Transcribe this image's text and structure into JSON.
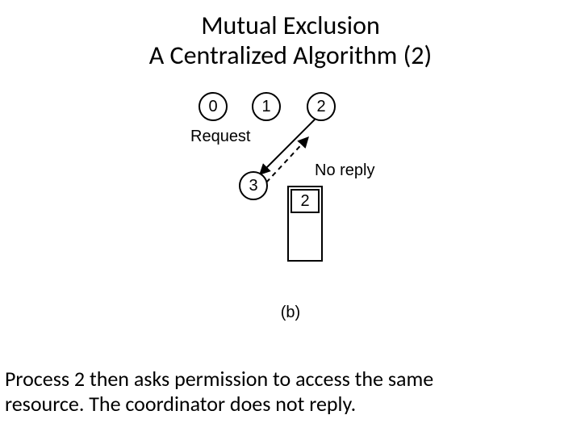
{
  "title_line1": "Mutual Exclusion",
  "title_line2": "A Centralized Algorithm (2)",
  "nodes": {
    "p0": "0",
    "p1": "1",
    "p2": "2",
    "coordinator": "3"
  },
  "labels": {
    "request": "Request",
    "no_reply": "No reply",
    "sublabel": "(b)"
  },
  "queue": {
    "item": "2"
  },
  "caption_line1": "Process 2 then asks permission to access the same",
  "caption_line2": "resource. The coordinator does not reply.",
  "chart_data": {
    "type": "diagram",
    "title": "Mutual Exclusion — A Centralized Algorithm (2)",
    "processes": [
      {
        "id": 0,
        "role": "process"
      },
      {
        "id": 1,
        "role": "process"
      },
      {
        "id": 2,
        "role": "process"
      },
      {
        "id": 3,
        "role": "coordinator"
      }
    ],
    "messages": [
      {
        "from": 2,
        "to": 3,
        "label": "Request",
        "style": "solid"
      },
      {
        "from": 3,
        "to": 2,
        "label": "No reply",
        "style": "dashed"
      }
    ],
    "coordinator_queue": [
      2
    ],
    "subfigure": "(b)",
    "caption": "Process 2 then asks permission to access the same resource. The coordinator does not reply."
  }
}
